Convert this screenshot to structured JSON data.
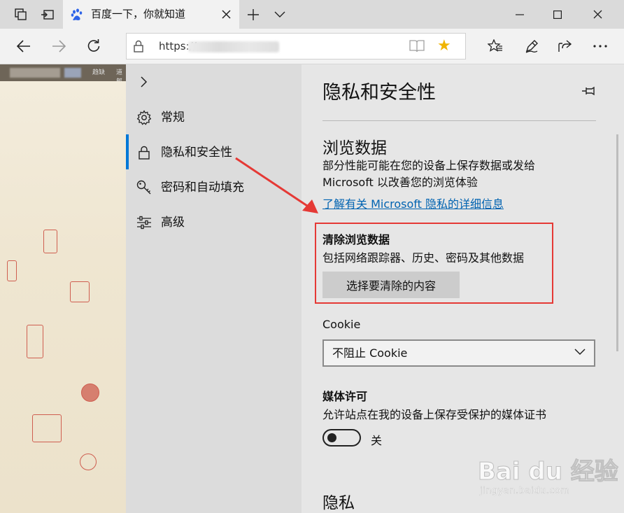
{
  "tab": {
    "title": "百度一下，你就知道",
    "favicon": "baidu-paw-icon"
  },
  "address_bar": {
    "url_prefix": "https://",
    "favorite_star_color": "#f0b400"
  },
  "page_background": {
    "strip_labels": [
      "趋缺",
      "道郎"
    ]
  },
  "settings": {
    "nav": {
      "items": [
        {
          "label": "常规",
          "icon": "gear-icon"
        },
        {
          "label": "隐私和安全性",
          "icon": "lock-icon",
          "active": true
        },
        {
          "label": "密码和自动填充",
          "icon": "key-icon"
        },
        {
          "label": "高级",
          "icon": "sliders-icon"
        }
      ],
      "accent_color": "#0078d7"
    },
    "title": "隐私和安全性",
    "browsing_data": {
      "heading": "浏览数据",
      "description": "部分性能可能在您的设备上保存数据或发给 Microsoft 以改善您的浏览体验",
      "link": "了解有关 Microsoft 隐私的详细信息"
    },
    "clear_data": {
      "title": "清除浏览数据",
      "description": "包括网络跟踪器、历史、密码及其他数据",
      "button": "选择要清除的内容"
    },
    "cookie": {
      "label": "Cookie",
      "selected": "不阻止 Cookie"
    },
    "media": {
      "title": "媒体许可",
      "description": "允许站点在我的设备上保存受保护的媒体证书",
      "toggle_state": "关",
      "toggle_on": false
    },
    "privacy_heading": "隐私"
  },
  "annotation": {
    "highlight_color": "#e53935"
  },
  "watermark": {
    "brand": "Bai du 经验",
    "url": "jingyan.baidu.com"
  }
}
